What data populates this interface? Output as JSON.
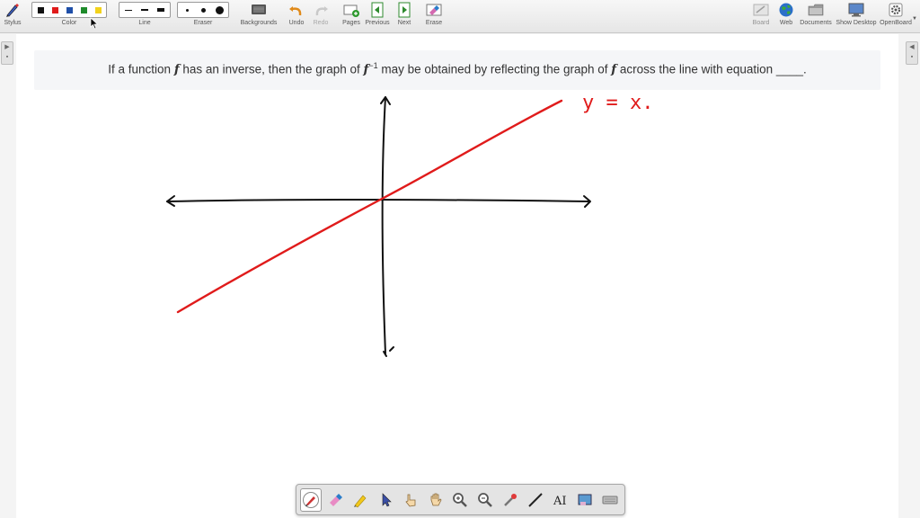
{
  "toolbar": {
    "stylus_label": "Stylus",
    "color_label": "Color",
    "line_label": "Line",
    "eraser_label": "Eraser",
    "backgrounds_label": "Backgrounds",
    "undo_label": "Undo",
    "redo_label": "Redo",
    "pages_label": "Pages",
    "previous_label": "Previous",
    "next_label": "Next",
    "erase_label": "Erase",
    "board_label": "Board",
    "web_label": "Web",
    "documents_label": "Documents",
    "show_desktop_label": "Show Desktop",
    "openboard_label": "OpenBoard",
    "colors": [
      "#111111",
      "#e01b1b",
      "#1f4fa8",
      "#1e8a2a",
      "#f2d21b"
    ],
    "line_widths": [
      "thin",
      "medium",
      "thick"
    ],
    "eraser_sizes": [
      "small",
      "medium",
      "large"
    ]
  },
  "question": {
    "part1": "If a function ",
    "f1": "f",
    "part2": " has an inverse, then the graph of ",
    "f2": "f",
    "exponent": "−1",
    "part3": " may be obtained by reflecting the graph of ",
    "f3": "f",
    "part4": " across the line with equation ____."
  },
  "annotation": {
    "text": "y = x.",
    "color": "#e01b1b"
  },
  "bottom_tools": [
    "pen-icon",
    "eraser-icon",
    "marker-icon",
    "pointer-icon",
    "hand-pointer-icon",
    "hand-icon",
    "zoom-in-icon",
    "zoom-out-icon",
    "laser-icon",
    "line-icon",
    "text-icon",
    "capture-icon",
    "keyboard-icon"
  ]
}
